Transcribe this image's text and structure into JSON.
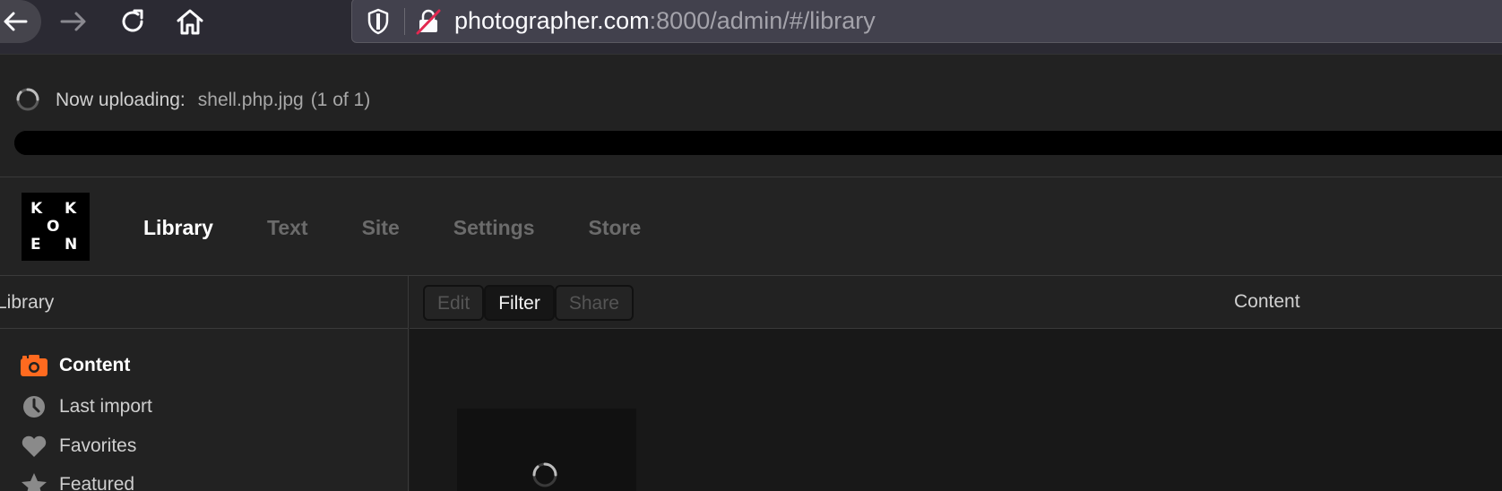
{
  "browser": {
    "url_host": "photographer.com",
    "url_path": ":8000/admin/#/library"
  },
  "upload": {
    "label": "Now uploading:",
    "filename": "shell.php.jpg",
    "count": "(1 of 1)",
    "progress_percent": 100
  },
  "app": {
    "logo": {
      "letters": [
        "K",
        "K",
        "O",
        "E",
        "N"
      ]
    },
    "nav": [
      {
        "label": "Library",
        "active": true
      },
      {
        "label": "Text",
        "active": false
      },
      {
        "label": "Site",
        "active": false
      },
      {
        "label": "Settings",
        "active": false
      },
      {
        "label": "Store",
        "active": false
      }
    ]
  },
  "sidebar": {
    "title": "Library",
    "items": [
      {
        "label": "Content",
        "icon": "camera-icon",
        "active": true
      },
      {
        "label": "Last import",
        "icon": "clock-icon",
        "active": false
      },
      {
        "label": "Favorites",
        "icon": "heart-icon",
        "active": false
      },
      {
        "label": "Featured",
        "icon": "star-icon",
        "active": false
      }
    ]
  },
  "toolbar": {
    "buttons": [
      {
        "label": "Edit",
        "active": false
      },
      {
        "label": "Filter",
        "active": true
      },
      {
        "label": "Share",
        "active": false
      }
    ],
    "title": "Content"
  },
  "colors": {
    "accent": "#ff6a1f",
    "background": "#1f1f1f",
    "panel": "#181818"
  }
}
